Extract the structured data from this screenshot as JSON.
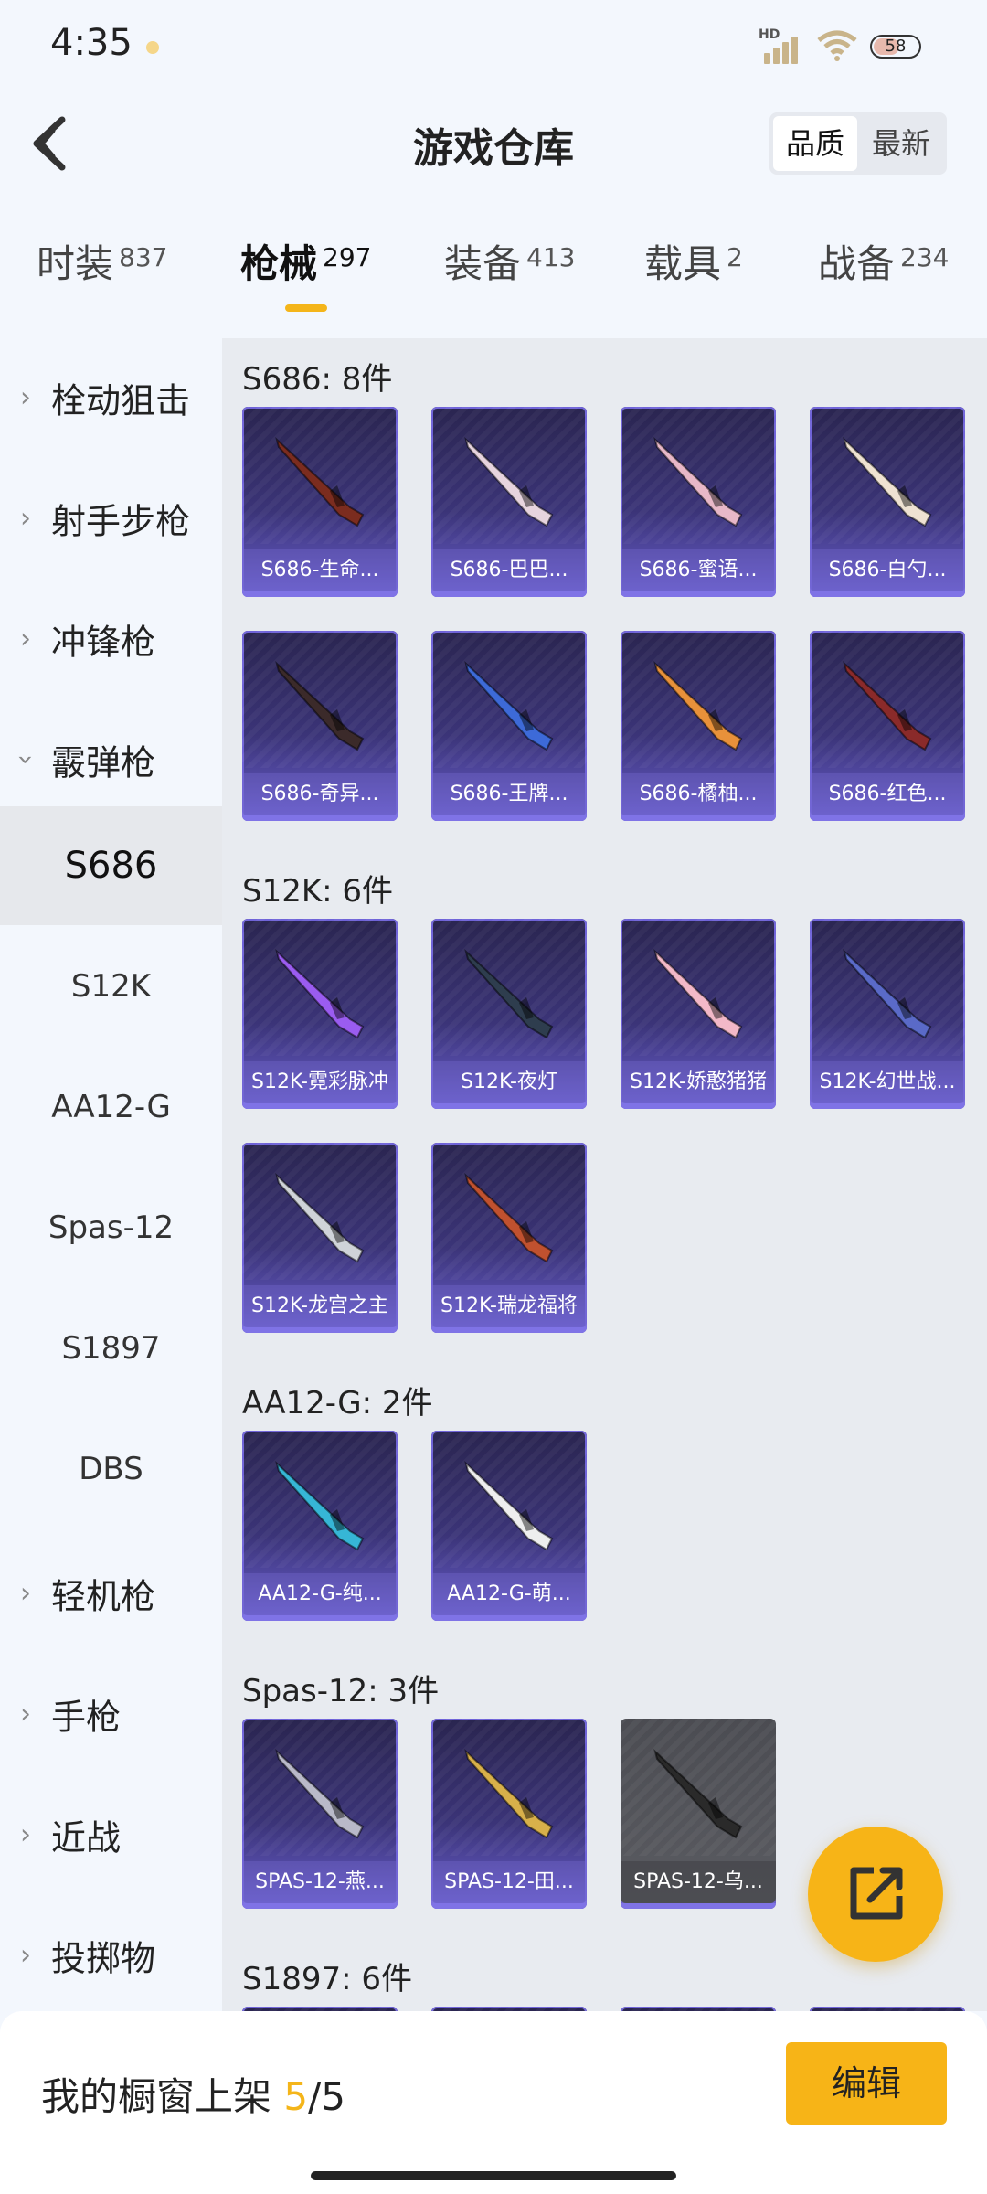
{
  "status_bar": {
    "time": "4:35",
    "signal_label": "HD",
    "battery": "58"
  },
  "header": {
    "title": "游戏仓库",
    "sort_options": [
      "品质",
      "最新"
    ],
    "sort_active": "品质"
  },
  "tabs": [
    {
      "label": "时装",
      "count": "837"
    },
    {
      "label": "枪械",
      "count": "297"
    },
    {
      "label": "装备",
      "count": "413"
    },
    {
      "label": "载具",
      "count": "2"
    },
    {
      "label": "战备",
      "count": "234"
    }
  ],
  "active_tab": "枪械",
  "sidebar": {
    "categories_top": [
      "栓动狙击",
      "射手步枪",
      "冲锋枪"
    ],
    "expanded": "霰弹枪",
    "subcategories": [
      "S686",
      "S12K",
      "AA12-G",
      "Spas-12",
      "S1897",
      "DBS"
    ],
    "active_sub": "S686",
    "categories_bottom": [
      "轻机枪",
      "手枪",
      "近战",
      "投掷物"
    ]
  },
  "groups": [
    {
      "title": "S686: 8件",
      "items": [
        "S686-生命...",
        "S686-巴巴...",
        "S686-蜜语...",
        "S686-白勺...",
        "S686-奇异...",
        "S686-王牌...",
        "S686-橘柚...",
        "S686-红色..."
      ]
    },
    {
      "title": "S12K: 6件",
      "items": [
        "S12K-霓彩脉冲",
        "S12K-夜灯",
        "S12K-娇憨猪猪",
        "S12K-幻世战...",
        "S12K-龙宫之主",
        "S12K-瑞龙福将"
      ]
    },
    {
      "title": "AA12-G: 2件",
      "items": [
        "AA12-G-纯...",
        "AA12-G-萌..."
      ]
    },
    {
      "title": "Spas-12: 3件",
      "items": [
        "SPAS-12-燕...",
        "SPAS-12-田...",
        "SPAS-12-乌..."
      ]
    },
    {
      "title": "S1897: 6件",
      "items": [
        "",
        "",
        "",
        ""
      ]
    }
  ],
  "bottom": {
    "showcase_label": "我的橱窗上架",
    "showcase_current": "5",
    "showcase_total": "/5",
    "edit_label": "编辑"
  },
  "colors": {
    "accent": "#f7b417",
    "card_purple": "#3b3478"
  }
}
